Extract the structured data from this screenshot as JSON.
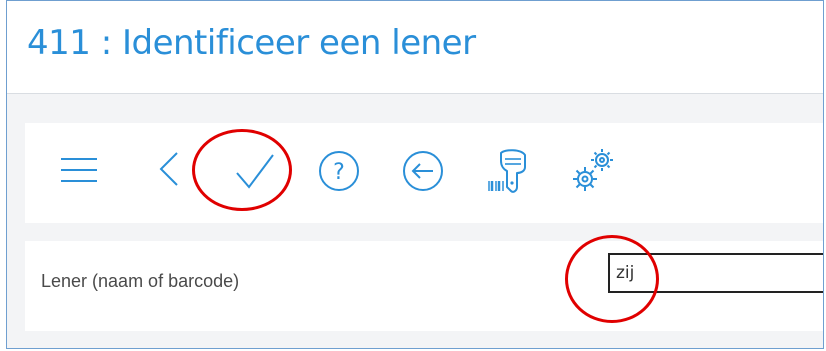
{
  "header": {
    "title": "411 : Identificeer een lener"
  },
  "toolbar": {
    "items": [
      {
        "name": "menu",
        "icon": "hamburger-icon"
      },
      {
        "name": "back",
        "icon": "chevron-left-icon"
      },
      {
        "name": "confirm",
        "icon": "checkmark-icon"
      },
      {
        "name": "help",
        "icon": "help-circle-icon",
        "glyph": "?"
      },
      {
        "name": "return",
        "icon": "arrow-left-circle-icon"
      },
      {
        "name": "scanner",
        "icon": "barcode-scanner-icon"
      },
      {
        "name": "settings",
        "icon": "gears-icon"
      }
    ]
  },
  "form": {
    "borrower_label": "Lener (naam of barcode)",
    "borrower_value": "zij"
  },
  "colors": {
    "accent": "#2a8fd8",
    "highlight": "#e00000"
  }
}
